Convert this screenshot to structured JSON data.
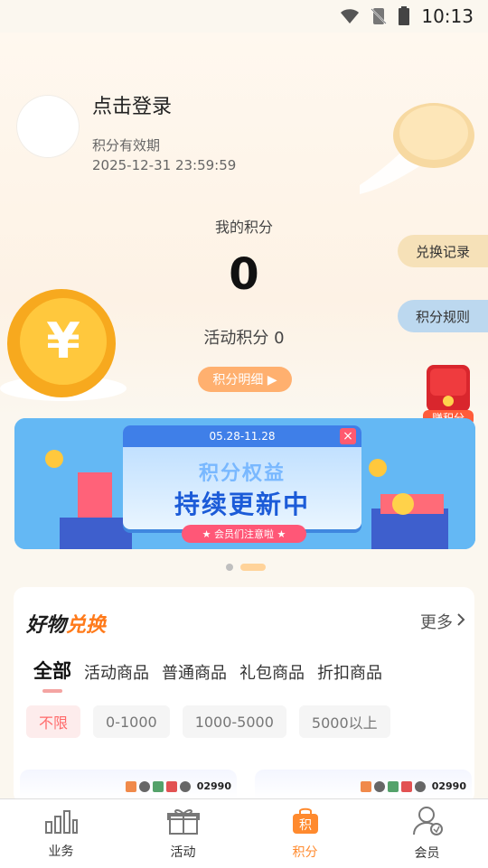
{
  "status_bar": {
    "time": "10:13"
  },
  "profile": {
    "login_title": "点击登录",
    "validity_label": "积分有效期",
    "validity_date": "2025-12-31 23:59:59"
  },
  "points": {
    "label": "我的积分",
    "value": "0",
    "activity_text": "活动积分 0",
    "detail_button": "积分明细 ▶"
  },
  "side_actions": {
    "exchange_record": "兑换记录",
    "rules": "积分规则",
    "earn_label": "赚积分"
  },
  "banner": {
    "dates": "05.28-11.28",
    "title1": "积分权益",
    "title2": "持续更新中",
    "strip": "★ 会员们注意啦 ★"
  },
  "goods": {
    "title_plain": "好物",
    "title_accent": "兑换",
    "more": "更多",
    "tabs": [
      "全部",
      "活动商品",
      "普通商品",
      "礼包商品",
      "折扣商品"
    ],
    "filters": [
      "不限",
      "0-1000",
      "1000-5000",
      "5000以上"
    ]
  },
  "preview": {
    "left_text": "02990",
    "right_text": "02990"
  },
  "nav": {
    "items": [
      {
        "label": "业务"
      },
      {
        "label": "活动"
      },
      {
        "label": "积分"
      },
      {
        "label": "会员"
      }
    ]
  },
  "colors": {
    "accent": "#ff8a2e",
    "pill_exchange": "#f6e1b8",
    "pill_rules": "#bcd8ef",
    "banner_blue": "#4aa6ee"
  }
}
